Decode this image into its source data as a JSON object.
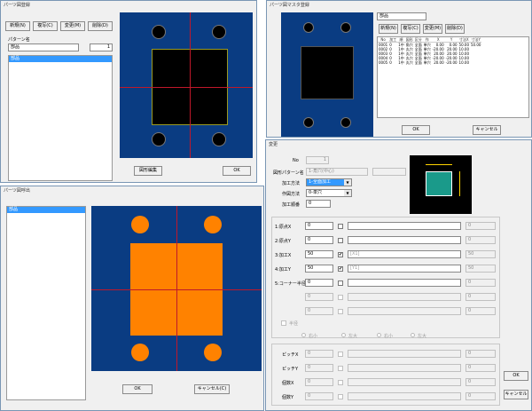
{
  "win1": {
    "title": "パーツ図登録",
    "new": "新規(N)",
    "copy": "複写(C)",
    "edit": "変更(M)",
    "del": "削除(D)",
    "pattern_label": "パターン名",
    "pattern_value": "部品",
    "count_value": "1",
    "list_items": [
      "部品"
    ],
    "shape_edit": "図形編集",
    "ok": "OK"
  },
  "win2": {
    "title": "パーツ図呼出",
    "list_items": [
      "部品"
    ],
    "ok": "OK",
    "cancel": "キャンセル(C)"
  },
  "win3": {
    "title": "パーツ図マスタ登録",
    "name_value": "部品",
    "new": "新規(N)",
    "copy": "複写(C)",
    "edit": "変更(M)",
    "del": "削除(D)",
    "columns": [
      "No",
      "加工",
      "順",
      "図形",
      "区分",
      "作",
      "X",
      "Y",
      "寸法X",
      "寸法Y"
    ],
    "rows": [
      [
        "0001",
        "0",
        "1中",
        "角穴",
        "全面",
        "単穴",
        "0.00",
        "0.00",
        "50.00",
        "50.00"
      ],
      [
        "0002",
        "0",
        "1中",
        "丸穴",
        "全面",
        "単穴",
        "-20.00",
        "20.00",
        "10.00",
        ""
      ],
      [
        "0003",
        "0",
        "1中",
        "丸穴",
        "全面",
        "単穴",
        "20.00",
        "20.00",
        "10.00",
        ""
      ],
      [
        "0004",
        "0",
        "1中",
        "丸穴",
        "全面",
        "単穴",
        "-20.00",
        "-20.00",
        "10.00",
        ""
      ],
      [
        "0005",
        "0",
        "1中",
        "丸穴",
        "全面",
        "単穴",
        "20.00",
        "-20.00",
        "10.00",
        ""
      ]
    ],
    "ok": "OK",
    "cancel": "キャンセル"
  },
  "win4": {
    "title": "変更",
    "no_label": "No",
    "no_value": "1",
    "pattern_label": "図形パターン名",
    "pattern_value": "1-角穴(中心)",
    "method_label": "加工方法",
    "method_value": "1-全面加工",
    "draw_label": "作図方法",
    "draw_value": "0-単穴",
    "order_label": "加工順番",
    "order_value": "0",
    "rows": [
      {
        "label": "1:原点X",
        "value": "0",
        "checked": false,
        "ref": "",
        "end": "0"
      },
      {
        "label": "2:原点Y",
        "value": "0",
        "checked": false,
        "ref": "",
        "end": "0"
      },
      {
        "label": "3:加工X",
        "value": "50",
        "checked": true,
        "ref": "[X1]",
        "end": "50"
      },
      {
        "label": "4:加工Y",
        "value": "50",
        "checked": true,
        "ref": "[Y1]",
        "end": "50"
      },
      {
        "label": "5:コーナー半径",
        "value": "0",
        "checked": false,
        "ref": "",
        "end": "0"
      },
      {
        "label": "",
        "value": "0",
        "checked": false,
        "ref": "",
        "end": "0"
      },
      {
        "label": "",
        "value": "0",
        "checked": false,
        "ref": "",
        "end": "0"
      },
      {
        "label": "",
        "value": "0",
        "checked": false,
        "ref": "",
        "end": "0"
      }
    ],
    "half_label": "半径",
    "radios": [
      "右小",
      "左大",
      "右小",
      "左大"
    ],
    "bottom_rows": [
      {
        "label": "ピッチX",
        "value": "0",
        "end": "0"
      },
      {
        "label": "ピッチY",
        "value": "0",
        "end": "0"
      },
      {
        "label": "個数X",
        "value": "0",
        "end": "0"
      },
      {
        "label": "個数Y",
        "value": "0",
        "end": "0"
      }
    ],
    "ok": "OK",
    "cancel": "キャンセル"
  },
  "colors": {
    "canvas": "#0a3c82",
    "orange": "#ff8200",
    "red_line": "#c0182a",
    "selection": "#3399ff"
  }
}
